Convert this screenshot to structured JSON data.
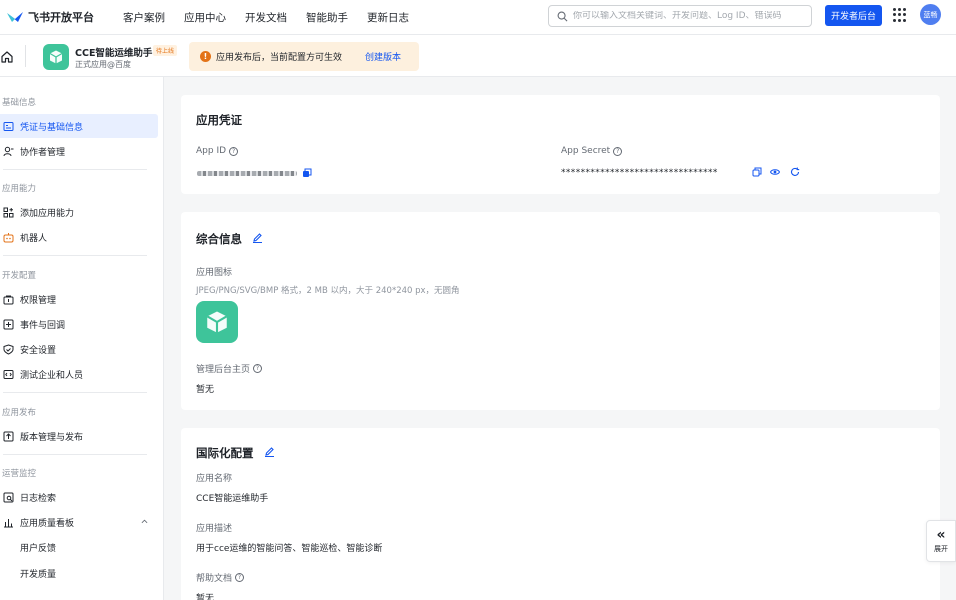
{
  "topnav": {
    "brand": "飞书开放平台",
    "links": [
      "客户案例",
      "应用中心",
      "开发文档",
      "智能助手",
      "更新日志"
    ],
    "search_placeholder": "你可以输入文档关键词、开发问题、Log ID、错误码",
    "dev_console": "开发者后台",
    "avatar_text": "蓝畅"
  },
  "app_header": {
    "app_name": "CCE智能运维助手",
    "status_badge": "待上线",
    "app_sub": "正式应用@百度",
    "notice_text": "应用发布后，当前配置方可生效",
    "notice_link": "创建版本"
  },
  "sidebar": {
    "groups": [
      "基础信息",
      "应用能力",
      "开发配置",
      "应用发布",
      "运营监控"
    ],
    "items": [
      {
        "label": "凭证与基础信息",
        "icon": "credential-icon"
      },
      {
        "label": "协作者管理",
        "icon": "collaborator-icon"
      },
      {
        "label": "添加应用能力",
        "icon": "add-capability-icon"
      },
      {
        "label": "机器人",
        "icon": "robot-icon"
      },
      {
        "label": "权限管理",
        "icon": "permission-icon"
      },
      {
        "label": "事件与回调",
        "icon": "event-icon"
      },
      {
        "label": "安全设置",
        "icon": "shield-icon"
      },
      {
        "label": "测试企业和人员",
        "icon": "test-icon"
      },
      {
        "label": "版本管理与发布",
        "icon": "version-icon"
      },
      {
        "label": "日志检索",
        "icon": "log-icon"
      },
      {
        "label": "应用质量看板",
        "icon": "chart-icon"
      },
      {
        "label": "用户反馈",
        "icon": ""
      },
      {
        "label": "开发质量",
        "icon": ""
      }
    ]
  },
  "credentials": {
    "title": "应用凭证",
    "app_id_label": "App ID",
    "app_secret_label": "App Secret",
    "app_secret_value": "********************************"
  },
  "general": {
    "title": "综合信息",
    "icon_label": "应用图标",
    "icon_hint": "JPEG/PNG/SVG/BMP 格式，2 MB 以内，大于 240*240 px，无圆角",
    "homepage_label": "管理后台主页",
    "homepage_value": "暂无"
  },
  "i18n": {
    "title": "国际化配置",
    "name_label": "应用名称",
    "name_value": "CCE智能运维助手",
    "desc_label": "应用描述",
    "desc_value": "用于cce运维的智能问答、智能巡检、智能诊断",
    "help_label": "帮助文档",
    "help_value": "暂无"
  },
  "expand": {
    "label": "展开"
  },
  "colors": {
    "accent": "#1456f0",
    "app_green": "#3ec49a",
    "notice_bg": "#fdf0de",
    "active_bg": "#e8efff"
  }
}
